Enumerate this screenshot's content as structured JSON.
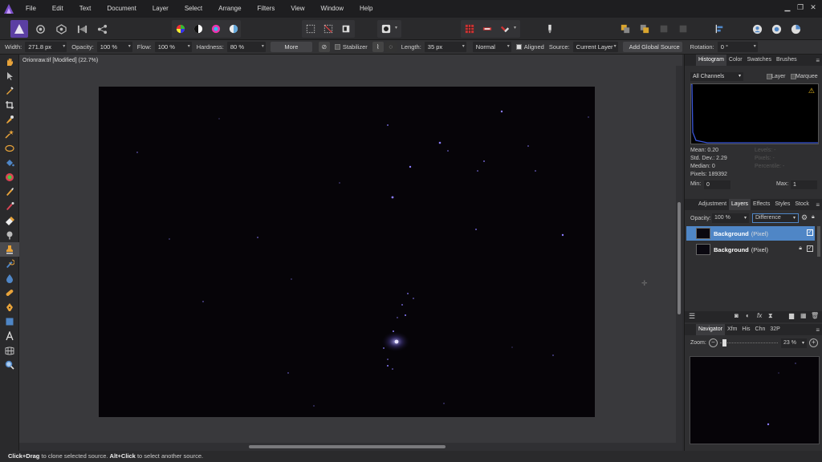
{
  "menu": [
    "File",
    "Edit",
    "Text",
    "Document",
    "Layer",
    "Select",
    "Arrange",
    "Filters",
    "View",
    "Window",
    "Help"
  ],
  "context": {
    "width_label": "Width:",
    "width_value": "271.8 px",
    "opacity_label": "Opacity:",
    "opacity_value": "100 %",
    "flow_label": "Flow:",
    "flow_value": "100 %",
    "hardness_label": "Hardness:",
    "hardness_value": "80 %",
    "more_label": "More",
    "stabilizer_label": "Stabilizer",
    "length_label": "Length:",
    "length_value": "35 px",
    "blend_value": "Normal",
    "aligned_label": "Aligned",
    "source_label": "Source:",
    "source_value": "Current Layer",
    "add_global_label": "Add Global Source",
    "rotation_label": "Rotation:",
    "rotation_value": "0 °"
  },
  "document": {
    "tab_title": "Orionraw.tif [Modified] (22.7%)"
  },
  "histogram_panel": {
    "tabs": [
      "Histogram",
      "Color",
      "Swatches",
      "Brushes"
    ],
    "channel": "All Channels",
    "layer_label": "Layer",
    "marquee_label": "Marquee",
    "mean": "Mean: 0.20",
    "std_dev": "Std. Dev.: 2.29",
    "median": "Median: 0",
    "pixels": "Pixels: 189392",
    "levels": "Levels: -",
    "count": "Pixels: -",
    "percentile": "Percentile: -",
    "min_label": "Min:",
    "min_value": "0",
    "max_label": "Max:",
    "max_value": "1"
  },
  "layers_panel": {
    "tabs": [
      "Adjustment",
      "Layers",
      "Effects",
      "Styles",
      "Stock"
    ],
    "opacity_label": "Opacity:",
    "opacity_value": "100 %",
    "blend_mode": "Difference",
    "layers": [
      {
        "name": "Background",
        "type": "(Pixel)"
      },
      {
        "name": "Background",
        "type": "(Pixel)"
      }
    ]
  },
  "navigator_panel": {
    "tabs": [
      "Navigator",
      "Xfm",
      "His",
      "Chn",
      "32P"
    ],
    "zoom_label": "Zoom:",
    "zoom_value": "23 %"
  },
  "status": {
    "key1": "Click+Drag",
    "text1": " to clone selected source. ",
    "key2": "Alt+Click",
    "text2": " to select another source."
  },
  "colors": {
    "accent": "#4f86c6",
    "canvas": "#060408",
    "panel": "#2f2f31"
  }
}
